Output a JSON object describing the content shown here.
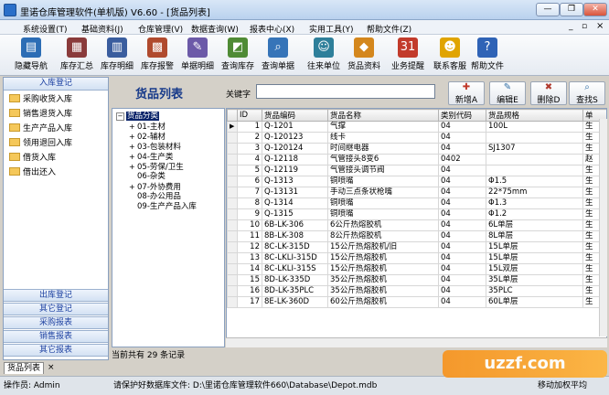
{
  "window": {
    "title": "里诺仓库管理软件(单机版) V6.60 - [货品列表]",
    "min": "—",
    "restore": "❐",
    "close": "✕",
    "child_min": "_",
    "child_restore": "▫",
    "child_close": "×"
  },
  "menu": [
    "系统设置(T)",
    "基础资料(J)",
    "仓库管理(V)",
    "数据查询(W)",
    "报表中心(X)",
    "实用工具(Y)",
    "帮助文件(Z)"
  ],
  "toolbar": [
    {
      "label": "隐藏导航",
      "icon": "nav-icon",
      "glyph": "▤",
      "color": "#2c6db5"
    },
    {
      "label": "库存汇总",
      "icon": "stock-summary-icon",
      "glyph": "▦",
      "color": "#8a3b3b"
    },
    {
      "label": "库存明细",
      "icon": "stock-detail-icon",
      "glyph": "▥",
      "color": "#3a5d9e"
    },
    {
      "label": "库存报警",
      "icon": "stock-alarm-icon",
      "glyph": "▩",
      "color": "#b04a2e"
    },
    {
      "label": "单据明细",
      "icon": "bill-detail-icon",
      "glyph": "✎",
      "color": "#6c5aa8"
    },
    {
      "label": "查询库存",
      "icon": "query-stock-icon",
      "glyph": "◩",
      "color": "#4f8b35"
    },
    {
      "label": "查询单据",
      "icon": "query-bill-icon",
      "glyph": "⌕",
      "color": "#3674b8"
    },
    {
      "label": "往来单位",
      "icon": "partners-icon",
      "glyph": "☺",
      "color": "#2e7f9a"
    },
    {
      "label": "货品资料",
      "icon": "goods-icon",
      "glyph": "◆",
      "color": "#d4871d"
    },
    {
      "label": "业务提醒",
      "icon": "calendar-icon",
      "glyph": "31",
      "color": "#c23b2b"
    },
    {
      "label": "联系客服",
      "icon": "support-icon",
      "glyph": "☻",
      "color": "#e0a400"
    },
    {
      "label": "帮助文件",
      "icon": "help-icon",
      "glyph": "?",
      "color": "#2f63b6"
    }
  ],
  "nav": {
    "top_header": "入库登记",
    "items": [
      "采购收货入库",
      "销售退货入库",
      "生产产品入库",
      "领用退回入库",
      "借货入库",
      "借出还入"
    ],
    "bottom_headers": [
      "出库登记",
      "其它登记",
      "采购报表",
      "销售报表",
      "其它报表"
    ]
  },
  "main": {
    "title": "货品列表",
    "keyword_label": "关键字",
    "keyword_value": ""
  },
  "buttons": [
    {
      "label": "新增A",
      "icon": "add-icon",
      "glyph": "✚",
      "color": "#c0392b"
    },
    {
      "label": "编辑E",
      "icon": "edit-icon",
      "glyph": "✎",
      "color": "#2e6da4"
    },
    {
      "label": "删除D",
      "icon": "delete-icon",
      "glyph": "✖",
      "color": "#b03a2e"
    },
    {
      "label": "查找S",
      "icon": "find-icon",
      "glyph": "⌕",
      "color": "#2e6da4"
    }
  ],
  "tree": {
    "root": "货品分类",
    "nodes": [
      {
        "label": "01-主材",
        "expand": "+"
      },
      {
        "label": "02-辅材",
        "expand": "+"
      },
      {
        "label": "03-包装材料",
        "expand": "+"
      },
      {
        "label": "04-生产类",
        "expand": "+"
      },
      {
        "label": "05-劳保/卫生",
        "expand": "+"
      },
      {
        "label": "06-杂类",
        "expand": ""
      },
      {
        "label": "07-外协费用",
        "expand": "+"
      },
      {
        "label": "08-办公用品",
        "expand": ""
      },
      {
        "label": "09-生产产品入库",
        "expand": ""
      }
    ]
  },
  "table": {
    "columns": [
      "ID",
      "货品编码",
      "货品名称",
      "类别代码",
      "货品规格",
      "单"
    ],
    "rows": [
      [
        "1",
        "Q-1201",
        "气撑",
        "04",
        "100L",
        "生"
      ],
      [
        "2",
        "Q-120123",
        "线卡",
        "04",
        "",
        "生"
      ],
      [
        "3",
        "Q-120124",
        "时间继电器",
        "04",
        "SJ1307",
        "生"
      ],
      [
        "4",
        "Q-12118",
        "气管接头8变6",
        "0402",
        "",
        "赵"
      ],
      [
        "5",
        "Q-12119",
        "气管接头调节阀",
        "04",
        "",
        "生"
      ],
      [
        "6",
        "Q-1313",
        "铜喷嘴",
        "04",
        "Φ1.5",
        "生"
      ],
      [
        "7",
        "Q-13131",
        "手动三点条状枪嘴",
        "04",
        "22*75mm",
        "生"
      ],
      [
        "8",
        "Q-1314",
        "铜喷嘴",
        "04",
        "Φ1.3",
        "生"
      ],
      [
        "9",
        "Q-1315",
        "铜喷嘴",
        "04",
        "Φ1.2",
        "生"
      ],
      [
        "10",
        "6B-LK-306",
        "6公斤热熔胶机",
        "04",
        "6L单层",
        "生"
      ],
      [
        "11",
        "8B-LK-308",
        "8公斤热熔胶机",
        "04",
        "8L单层",
        "生"
      ],
      [
        "12",
        "8C-LK-315D",
        "15公斤热熔胶机/旧",
        "04",
        "15L单层",
        "生"
      ],
      [
        "13",
        "8C-LKLI-315D",
        "15公斤热熔胶机",
        "04",
        "15L单层",
        "生"
      ],
      [
        "14",
        "8C-LKLI-315S",
        "15公斤热熔胶机",
        "04",
        "15L双层",
        "生"
      ],
      [
        "15",
        "8D-LK-335D",
        "35公斤热熔胶机",
        "04",
        "35L单层",
        "生"
      ],
      [
        "16",
        "8D-LK-35PLC",
        "35公斤热熔胶机",
        "04",
        "35PLC",
        "生"
      ],
      [
        "17",
        "8E-LK-360D",
        "60公斤热熔胶机",
        "04",
        "60L单层",
        "生"
      ]
    ]
  },
  "record_count": "当前共有 29 条记录",
  "doc_tab": "货品列表",
  "status": {
    "operator": "操作员: Admin",
    "path": "请保护好数据库文件: D:\\里诺仓库管理软件660\\Database\\Depot.mdb",
    "mode": "移动加权平均"
  },
  "watermark": "uzzf.com"
}
